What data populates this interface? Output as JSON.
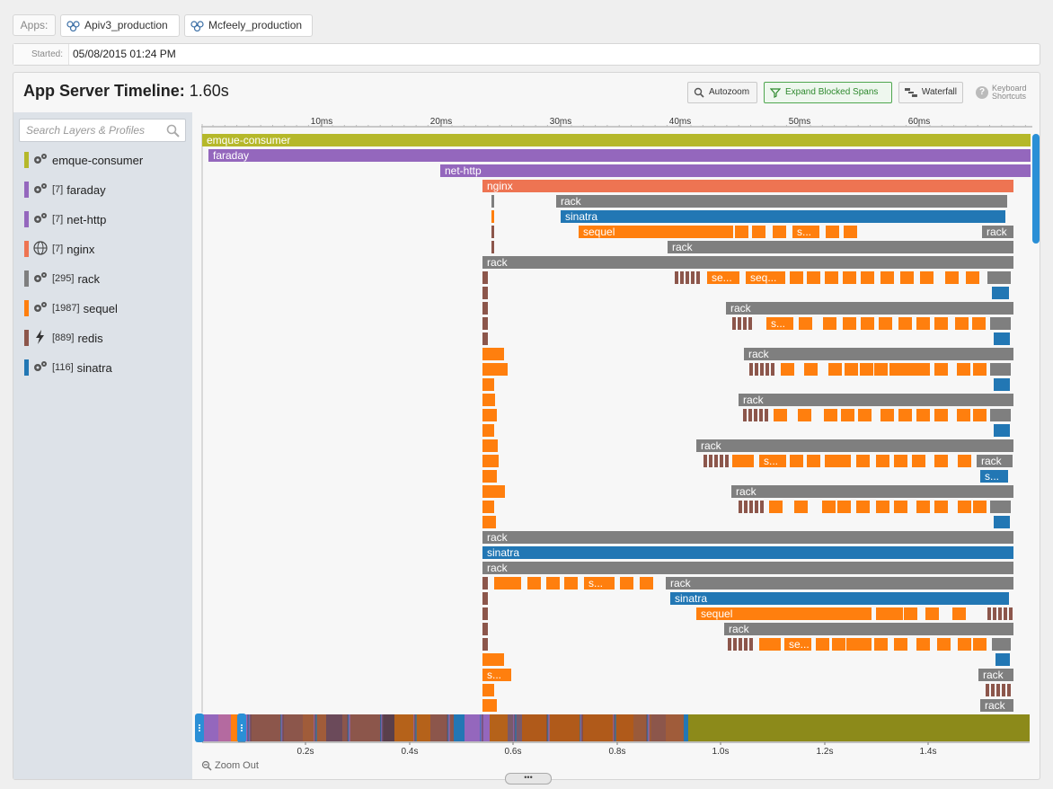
{
  "apps": {
    "label": "Apps:",
    "tabs": [
      {
        "label": "Apiv3_production"
      },
      {
        "label": "Mcfeely_production"
      }
    ]
  },
  "started": {
    "label": "Started:",
    "value": "05/08/2015 01:24 PM"
  },
  "panel": {
    "title": "App Server Timeline:",
    "duration": "1.60s",
    "buttons": {
      "autozoom": "Autozoom",
      "expand": "Expand Blocked Spans",
      "waterfall": "Waterfall",
      "keyboard_line1": "Keyboard",
      "keyboard_line2": "Shortcuts"
    }
  },
  "search": {
    "placeholder": "Search Layers & Profiles"
  },
  "layers": [
    {
      "count": "",
      "name": "emque-consumer",
      "color": "#b5b82a",
      "icon": "gears-icon"
    },
    {
      "count": "[7]",
      "name": "faraday",
      "color": "#9467bd",
      "icon": "gears-icon"
    },
    {
      "count": "[7]",
      "name": "net-http",
      "color": "#9467bd",
      "icon": "gears-icon"
    },
    {
      "count": "[7]",
      "name": "nginx",
      "color": "#ee7452",
      "icon": "globe-icon"
    },
    {
      "count": "[295]",
      "name": "rack",
      "color": "#7f7f7f",
      "icon": "gears-icon"
    },
    {
      "count": "[1987]",
      "name": "sequel",
      "color": "#ff7f0e",
      "icon": "gears-icon"
    },
    {
      "count": "[889]",
      "name": "redis",
      "color": "#8c564b",
      "icon": "bolt-icon"
    },
    {
      "count": "[116]",
      "name": "sinatra",
      "color": "#2277b4",
      "icon": "gears-icon"
    }
  ],
  "axis": {
    "ticks": [
      "10ms",
      "20ms",
      "30ms",
      "40ms",
      "50ms",
      "60ms"
    ],
    "overview_ticks": [
      "0.2s",
      "0.4s",
      "0.6s",
      "0.8s",
      "1.0s",
      "1.2s",
      "1.4s"
    ]
  },
  "colors": {
    "emque": "#b5b82a",
    "faraday": "#9467bd",
    "nethttp": "#9467bd",
    "nginx": "#ee7452",
    "rack": "#7f7f7f",
    "sequel": "#ff7f0e",
    "redis": "#8c564b",
    "sinatra": "#2277b4"
  },
  "spans": {
    "emque": "emque-consumer",
    "faraday": "faraday",
    "nethttp": "net-http",
    "nginx": "nginx",
    "rack": "rack",
    "sinatra": "sinatra",
    "sequel": "sequel",
    "seq_trunc": "seq...",
    "s_trunc": "s...",
    "se_trunc": "se...",
    "sinatra_trunc": "s..."
  },
  "zoom_out": "Zoom Out"
}
